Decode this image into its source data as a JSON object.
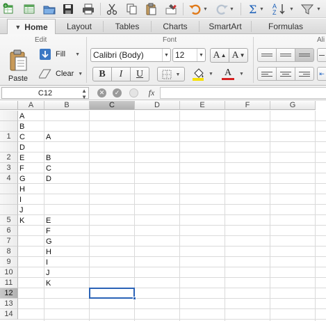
{
  "toolbar": {
    "icons": [
      "new-icon",
      "open-icon",
      "save-icon",
      "print-icon",
      "cut-icon",
      "copy-icon",
      "paste-icon",
      "format-painter-icon",
      "undo-icon",
      "redo-icon",
      "autosum-icon",
      "sort-icon",
      "filter-icon"
    ]
  },
  "tabs": [
    {
      "label": "Home",
      "active": true
    },
    {
      "label": "Layout",
      "active": false
    },
    {
      "label": "Tables",
      "active": false
    },
    {
      "label": "Charts",
      "active": false
    },
    {
      "label": "SmartArt",
      "active": false
    },
    {
      "label": "Formulas",
      "active": false
    }
  ],
  "ribbon": {
    "edit": {
      "title": "Edit",
      "paste_label": "Paste",
      "fill_label": "Fill",
      "clear_label": "Clear"
    },
    "font": {
      "title": "Font",
      "font_name": "Calibri (Body)",
      "font_size": "12",
      "bold_label": "B",
      "italic_label": "I",
      "underline_label": "U",
      "grow_label": "A",
      "shrink_label": "A",
      "font_color_label": "A",
      "fill_color": "#f6e000",
      "font_color": "#d62020"
    },
    "alignment_title_partial": "Ali"
  },
  "formula_bar": {
    "name_box": "C12",
    "fx_label": "fx",
    "formula": ""
  },
  "grid": {
    "columns": [
      "A",
      "B",
      "C",
      "D",
      "E",
      "F",
      "G"
    ],
    "selected_column": "C",
    "selected_row": "12",
    "rows": [
      {
        "label": "",
        "a": "A",
        "b": ""
      },
      {
        "label": "",
        "a": "B",
        "b": ""
      },
      {
        "label": "1",
        "a": "C",
        "b": "A"
      },
      {
        "label": "",
        "a": "D",
        "b": ""
      },
      {
        "label": "2",
        "a": "E",
        "b": "B"
      },
      {
        "label": "3",
        "a": "F",
        "b": "C"
      },
      {
        "label": "4",
        "a": "G",
        "b": "D"
      },
      {
        "label": "",
        "a": "H",
        "b": ""
      },
      {
        "label": "",
        "a": "I",
        "b": ""
      },
      {
        "label": "",
        "a": "J",
        "b": ""
      },
      {
        "label": "5",
        "a": "K",
        "b": "E"
      },
      {
        "label": "6",
        "a": "",
        "b": "F"
      },
      {
        "label": "7",
        "a": "",
        "b": "G"
      },
      {
        "label": "8",
        "a": "",
        "b": "H"
      },
      {
        "label": "9",
        "a": "",
        "b": "I"
      },
      {
        "label": "10",
        "a": "",
        "b": "J"
      },
      {
        "label": "11",
        "a": "",
        "b": "K"
      },
      {
        "label": "12",
        "a": "",
        "b": ""
      },
      {
        "label": "13",
        "a": "",
        "b": ""
      },
      {
        "label": "14",
        "a": "",
        "b": ""
      }
    ]
  }
}
